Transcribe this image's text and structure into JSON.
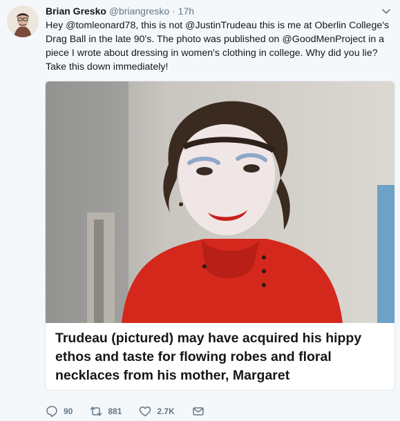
{
  "tweet": {
    "author_name": "Brian Gresko",
    "author_handle": "@briangresko",
    "separator": "·",
    "time": "17h",
    "text_lines": [
      "Hey @tomleonard78, this is not @JustinTrudeau this is me at Oberlin College's",
      "Drag Ball in the late 90's. The photo was published on @GoodMenProject in a",
      "piece I wrote about dressing in women's clothing in college. Why did you lie?",
      "Take this down immediately!"
    ]
  },
  "card": {
    "headline_lines": [
      "Trudeau (pictured) may have acquired his hippy",
      "ethos and taste for flowing robes and floral",
      "necklaces from his mother, Margaret"
    ]
  },
  "actions": {
    "reply_count": "90",
    "retweet_count": "881",
    "like_count": "2.7K"
  },
  "icons": {
    "reply": "reply-icon",
    "retweet": "retweet-icon",
    "like": "heart-icon",
    "dm": "envelope-icon",
    "more": "chevron-down-icon"
  },
  "colors": {
    "background": "#f5f8fa",
    "text": "#14171a",
    "secondary": "#657786",
    "card_border": "#e1e8ed"
  }
}
